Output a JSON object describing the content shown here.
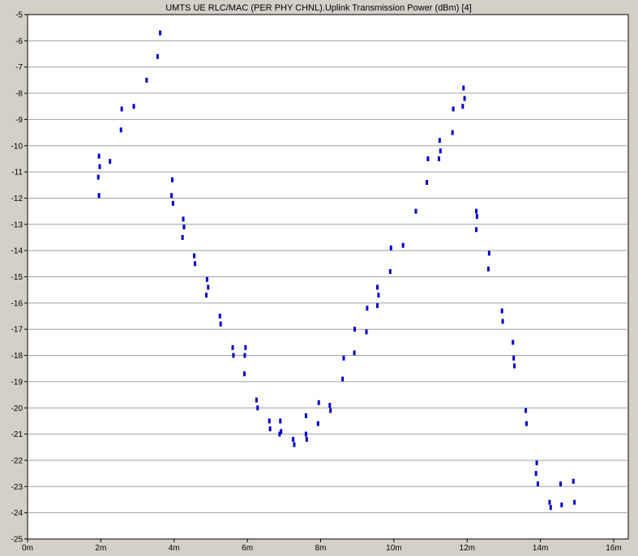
{
  "chart_data": {
    "type": "scatter",
    "title": "UMTS UE RLC/MAC (PER PHY CHNL).Uplink Transmission Power (dBm) [4]",
    "xlabel": "",
    "ylabel": "",
    "xlim": [
      0,
      16
    ],
    "ylim": [
      -25,
      -5
    ],
    "x_ticks": [
      0,
      2,
      4,
      6,
      8,
      10,
      12,
      14,
      16
    ],
    "x_tick_labels": [
      "0m",
      "2m",
      "4m",
      "6m",
      "8m",
      "10m",
      "12m",
      "14m",
      "16m"
    ],
    "y_ticks": [
      -5,
      -6,
      -7,
      -8,
      -9,
      -10,
      -11,
      -12,
      -13,
      -14,
      -15,
      -16,
      -17,
      -18,
      -19,
      -20,
      -21,
      -22,
      -23,
      -24,
      -25
    ],
    "y_tick_labels": [
      "-5",
      "-6",
      "-7",
      "-8",
      "-9",
      "-10",
      "-11",
      "-12",
      "-13",
      "-14",
      "-15",
      "-16",
      "-17",
      "-18",
      "-19",
      "-20",
      "-21",
      "-22",
      "-23",
      "-24",
      "-25"
    ],
    "grid": true,
    "legend": "none",
    "colors": {
      "point": "#0000cc",
      "plot_bg": "#ffffff",
      "grid": "#a0a0a0",
      "frame_bg": "#d4d0c8"
    },
    "series": [
      {
        "points": [
          [
            1.95,
            -10.4
          ],
          [
            1.97,
            -10.8
          ],
          [
            1.93,
            -11.2
          ],
          [
            1.95,
            -11.9
          ],
          [
            2.25,
            -10.6
          ],
          [
            2.55,
            -9.4
          ],
          [
            2.57,
            -8.6
          ],
          [
            2.9,
            -8.5
          ],
          [
            3.25,
            -7.5
          ],
          [
            3.55,
            -6.6
          ],
          [
            3.62,
            -5.7
          ],
          [
            3.95,
            -11.3
          ],
          [
            3.93,
            -11.9
          ],
          [
            3.97,
            -12.2
          ],
          [
            4.25,
            -12.8
          ],
          [
            4.27,
            -13.1
          ],
          [
            4.23,
            -13.5
          ],
          [
            4.55,
            -14.2
          ],
          [
            4.57,
            -14.5
          ],
          [
            4.9,
            -15.1
          ],
          [
            4.93,
            -15.4
          ],
          [
            4.88,
            -15.7
          ],
          [
            5.25,
            -16.5
          ],
          [
            5.27,
            -16.8
          ],
          [
            5.6,
            -17.7
          ],
          [
            5.62,
            -18.0
          ],
          [
            5.95,
            -17.7
          ],
          [
            5.93,
            -18.0
          ],
          [
            5.92,
            -18.7
          ],
          [
            6.25,
            -19.7
          ],
          [
            6.28,
            -20.0
          ],
          [
            6.6,
            -20.5
          ],
          [
            6.62,
            -20.8
          ],
          [
            6.9,
            -20.5
          ],
          [
            6.92,
            -20.9
          ],
          [
            6.88,
            -21.0
          ],
          [
            7.25,
            -21.2
          ],
          [
            7.28,
            -21.4
          ],
          [
            7.6,
            -21.0
          ],
          [
            7.62,
            -21.2
          ],
          [
            7.6,
            -20.3
          ],
          [
            7.95,
            -19.8
          ],
          [
            7.93,
            -20.6
          ],
          [
            8.25,
            -19.9
          ],
          [
            8.27,
            -20.1
          ],
          [
            8.6,
            -18.9
          ],
          [
            8.63,
            -18.1
          ],
          [
            8.93,
            -17.0
          ],
          [
            8.92,
            -17.9
          ],
          [
            9.25,
            -17.1
          ],
          [
            9.27,
            -16.2
          ],
          [
            9.55,
            -15.4
          ],
          [
            9.58,
            -15.7
          ],
          [
            9.55,
            -16.1
          ],
          [
            9.9,
            -14.8
          ],
          [
            9.92,
            -13.9
          ],
          [
            10.25,
            -13.8
          ],
          [
            10.6,
            -12.5
          ],
          [
            10.9,
            -11.4
          ],
          [
            10.93,
            -10.5
          ],
          [
            11.25,
            -9.8
          ],
          [
            11.27,
            -10.2
          ],
          [
            11.23,
            -10.5
          ],
          [
            11.6,
            -9.5
          ],
          [
            11.62,
            -8.6
          ],
          [
            11.9,
            -7.8
          ],
          [
            11.93,
            -8.2
          ],
          [
            11.88,
            -8.5
          ],
          [
            12.25,
            -12.5
          ],
          [
            12.27,
            -12.7
          ],
          [
            12.25,
            -13.2
          ],
          [
            12.6,
            -14.1
          ],
          [
            12.58,
            -14.7
          ],
          [
            12.95,
            -16.3
          ],
          [
            12.97,
            -16.7
          ],
          [
            13.25,
            -17.5
          ],
          [
            13.27,
            -18.1
          ],
          [
            13.29,
            -18.4
          ],
          [
            13.6,
            -20.1
          ],
          [
            13.62,
            -20.6
          ],
          [
            13.9,
            -22.1
          ],
          [
            13.88,
            -22.5
          ],
          [
            13.93,
            -22.9
          ],
          [
            14.25,
            -23.6
          ],
          [
            14.28,
            -23.8
          ],
          [
            14.55,
            -22.9
          ],
          [
            14.58,
            -23.7
          ],
          [
            14.9,
            -22.8
          ],
          [
            14.93,
            -23.6
          ]
        ]
      }
    ]
  }
}
